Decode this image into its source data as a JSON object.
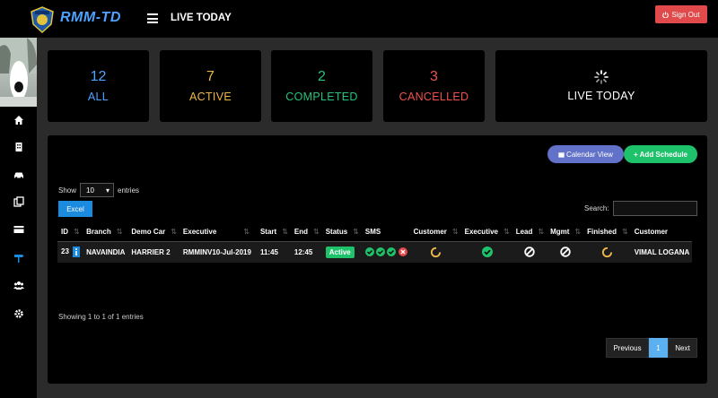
{
  "header": {
    "app_name": "RMM-TD",
    "page_title": "LIVE TODAY",
    "signout_label": "Sign Out"
  },
  "colors": {
    "all": "#4da3ff",
    "active": "#f0b84a",
    "completed": "#29c27a",
    "cancelled": "#ef5050",
    "green": "#1ec26b",
    "blue": "#1b8be0",
    "red": "#e04a4a"
  },
  "sidebar": {
    "items": [
      {
        "icon": "home-icon"
      },
      {
        "icon": "building-icon"
      },
      {
        "icon": "car-icon"
      },
      {
        "icon": "copy-icon"
      },
      {
        "icon": "credit-card-icon"
      },
      {
        "icon": "signpost-icon"
      },
      {
        "icon": "users-icon"
      },
      {
        "icon": "gear-icon"
      }
    ]
  },
  "stats": [
    {
      "num": "12",
      "label": "ALL"
    },
    {
      "num": "7",
      "label": "ACTIVE"
    },
    {
      "num": "2",
      "label": "COMPLETED"
    },
    {
      "num": "3",
      "label": "CANCELLED"
    }
  ],
  "live_card": {
    "label": "LIVE TODAY"
  },
  "toolbar": {
    "calendar_label": "Calendar View",
    "add_label": "Add Schedule",
    "show_label": "Show",
    "entries_label": "entries",
    "page_size": "10",
    "excel_label": "Excel",
    "search_label": "Search:"
  },
  "table": {
    "columns": [
      "ID",
      "Branch",
      "Demo Car",
      "Executive",
      "Start",
      "End",
      "Status",
      "SMS",
      "Customer",
      "Executive",
      "Lead",
      "Mgmt",
      "Finished",
      "Customer"
    ],
    "rows": [
      {
        "id": "23",
        "branch": "NAVAINDIA",
        "demo_car": "HARRIER 2",
        "executive": "RMMINV10-Jul-2019",
        "start": "11:45",
        "end": "12:45",
        "status": "Active",
        "customer_name": "VIMAL LOGANA"
      }
    ]
  },
  "footer": {
    "showing": "Showing 1 to 1 of 1 entries",
    "prev": "Previous",
    "page": "1",
    "next": "Next"
  }
}
